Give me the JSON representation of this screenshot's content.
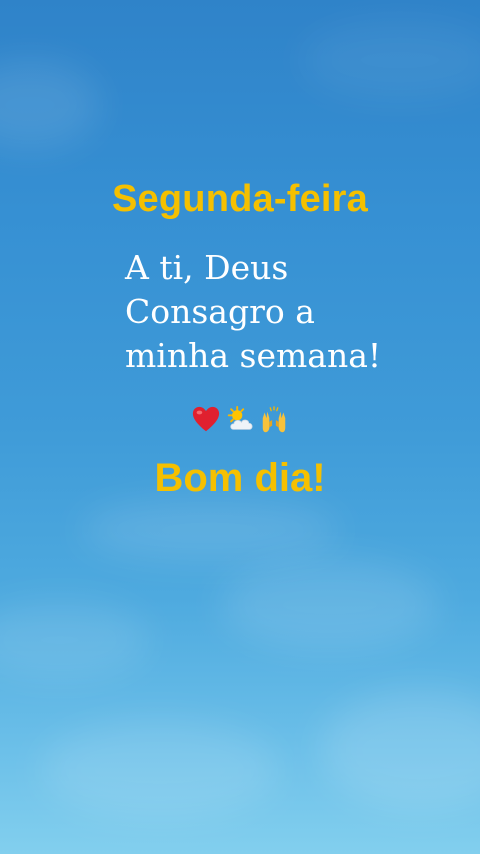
{
  "background": {
    "top_color": "#2f83c9",
    "bottom_color": "#82cfee"
  },
  "heading": {
    "day": "Segunda-feira",
    "color": "#f5c000"
  },
  "verse": {
    "lines": [
      "A ti, Deus",
      "Consagro a",
      "minha semana!"
    ],
    "color": "#ffffff"
  },
  "emojis": [
    "heart-icon",
    "sun-behind-cloud-icon",
    "raised-hands-icon"
  ],
  "greeting": {
    "text": "Bom dia!",
    "color": "#f5c000"
  }
}
